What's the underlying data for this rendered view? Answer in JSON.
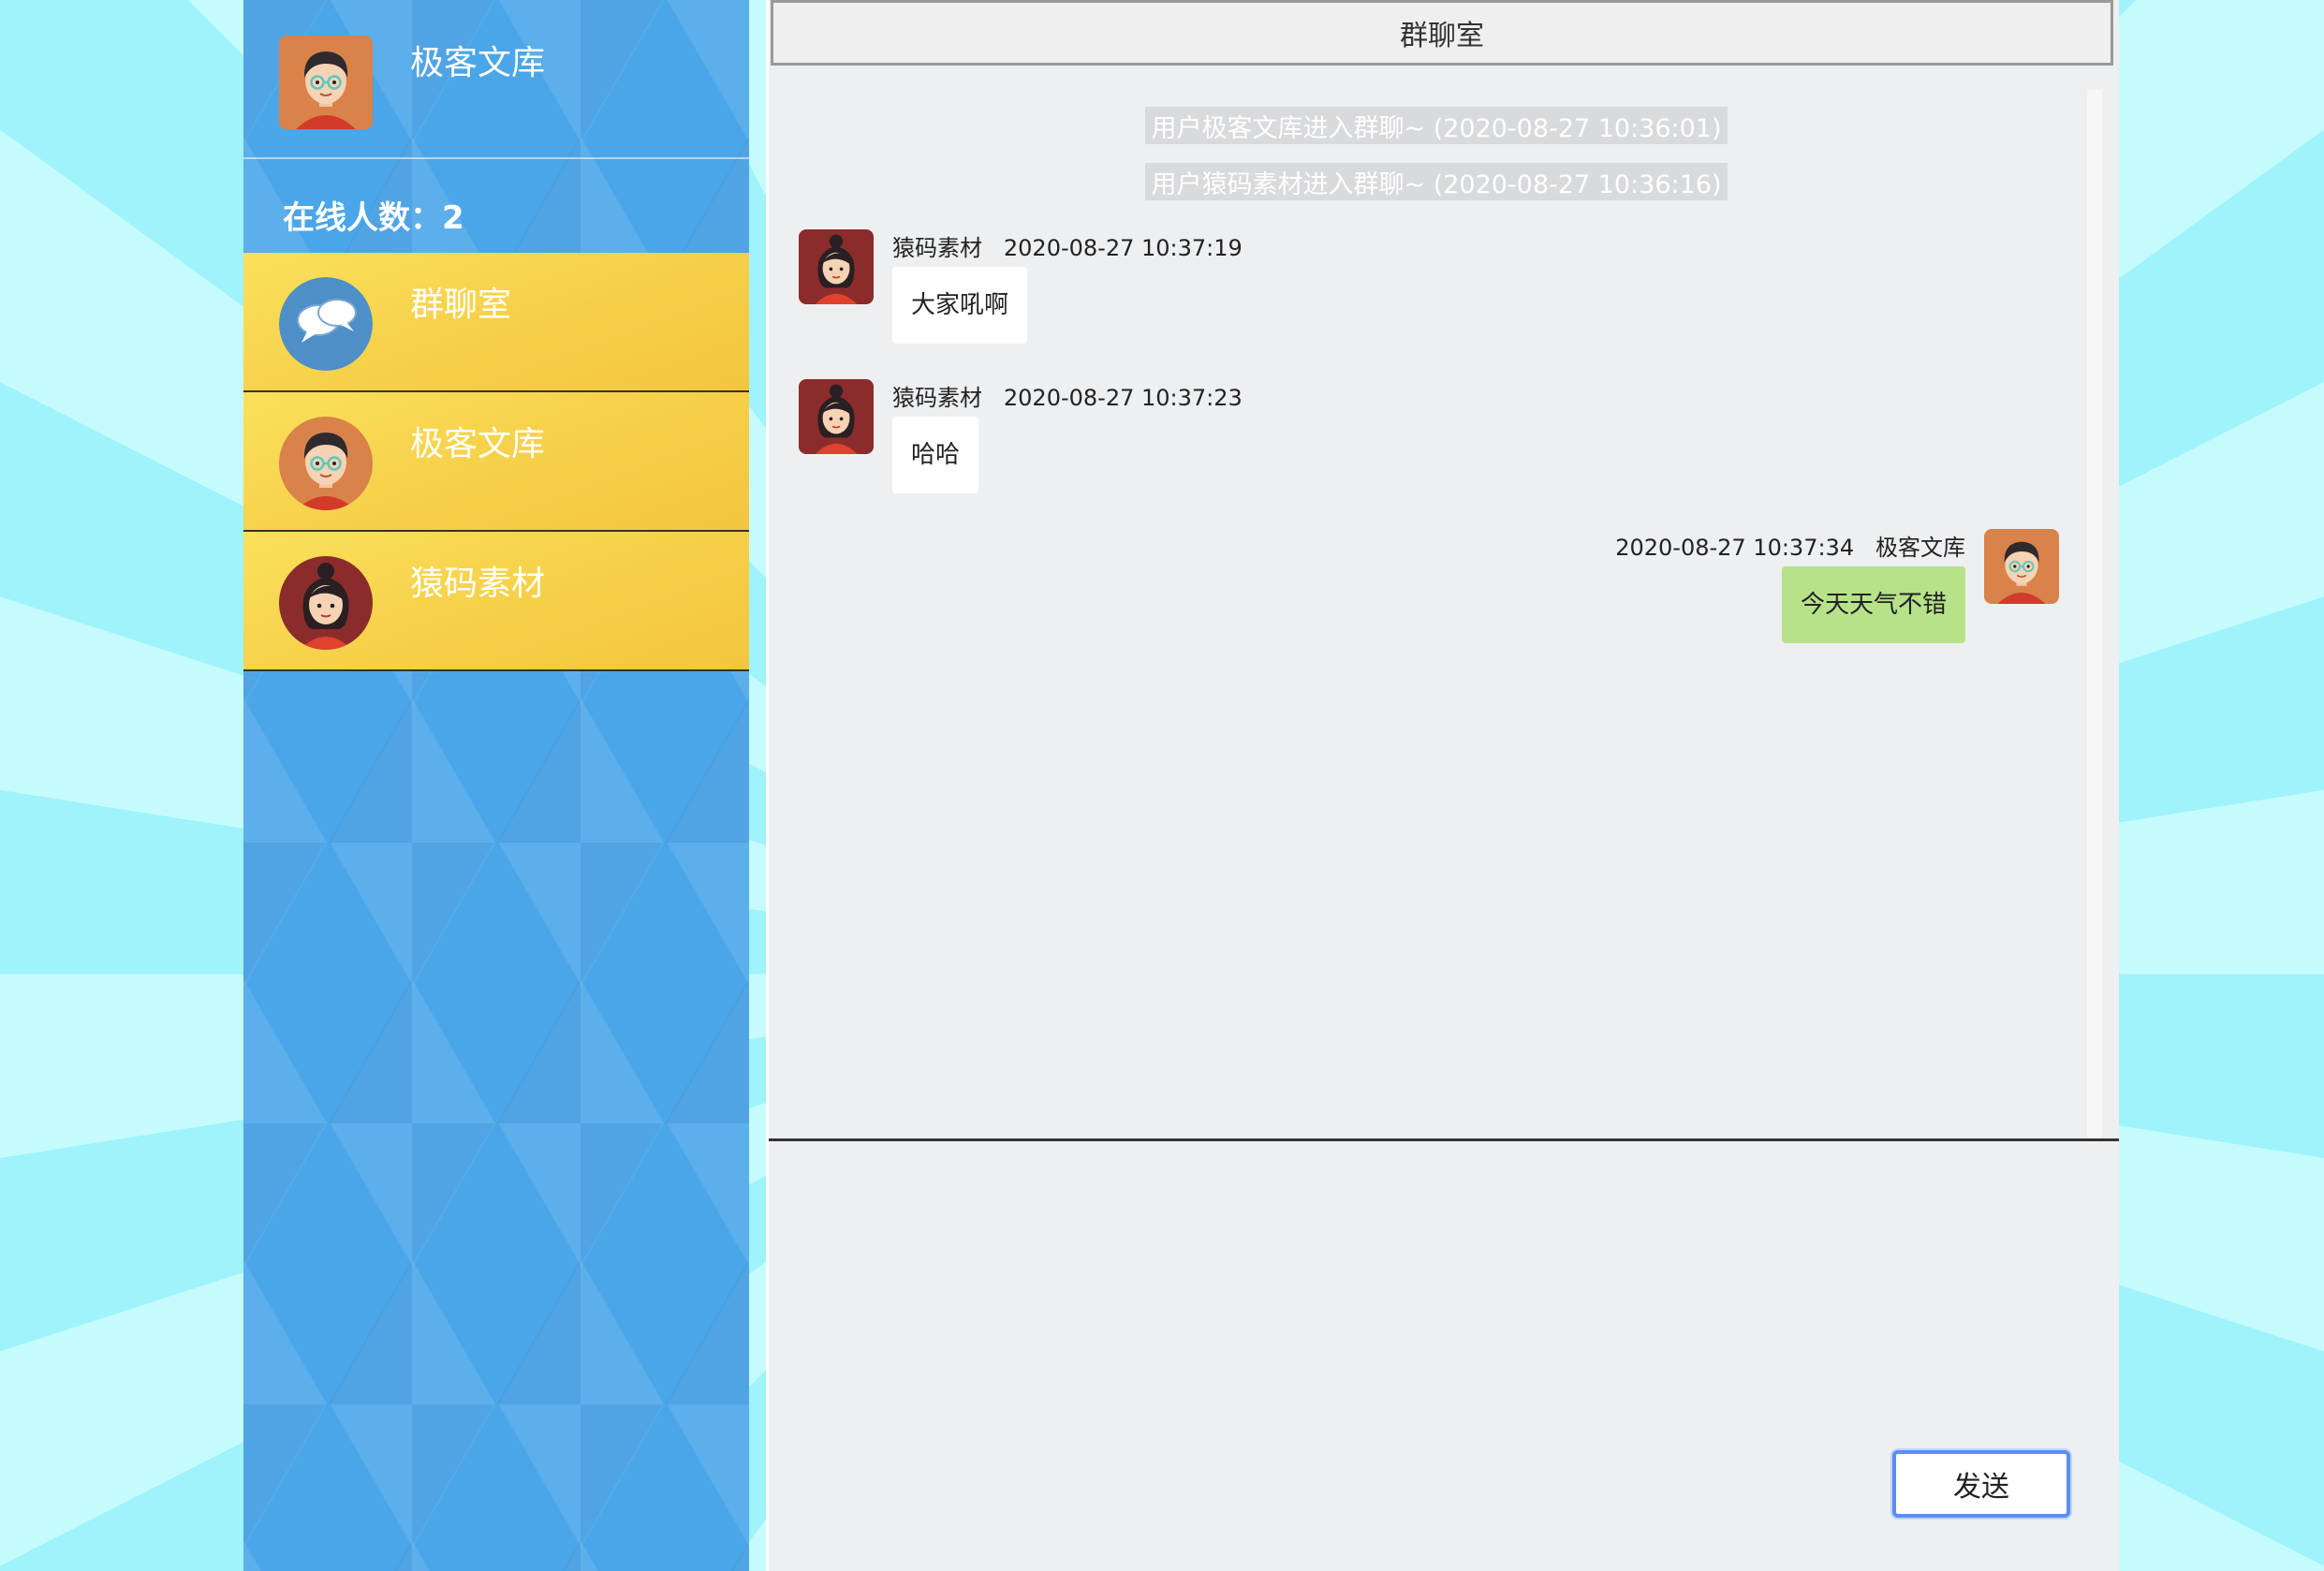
{
  "user": {
    "name": "极客文库"
  },
  "online": {
    "label": "在线人数：2"
  },
  "chat_list": [
    {
      "label": "群聊室",
      "icon": "chat-bubbles-icon"
    },
    {
      "label": "极客文库",
      "icon": "boy-avatar-icon"
    },
    {
      "label": "猿码素材",
      "icon": "girl-avatar-icon"
    }
  ],
  "room": {
    "title": "群聊室"
  },
  "system_messages": [
    "用户极客文库进入群聊~ (2020-08-27 10:36:01)",
    "用户猿码素材进入群聊~ (2020-08-27 10:36:16)"
  ],
  "messages": [
    {
      "sender": "猿码素材",
      "time": "2020-08-27 10:37:19",
      "text": "大家吼啊"
    },
    {
      "sender": "猿码素材",
      "time": "2020-08-27 10:37:23",
      "text": "哈哈"
    },
    {
      "sender": "极客文库",
      "time": "2020-08-27 10:37:34",
      "text": "今天天气不错"
    }
  ],
  "composer": {
    "send_label": "发送"
  },
  "colors": {
    "sidebar_bg": "#4aa6e8",
    "chat_item_bg": "#f6cf48",
    "my_bubble": "#b7e28a",
    "send_border": "#5a8ef0"
  }
}
